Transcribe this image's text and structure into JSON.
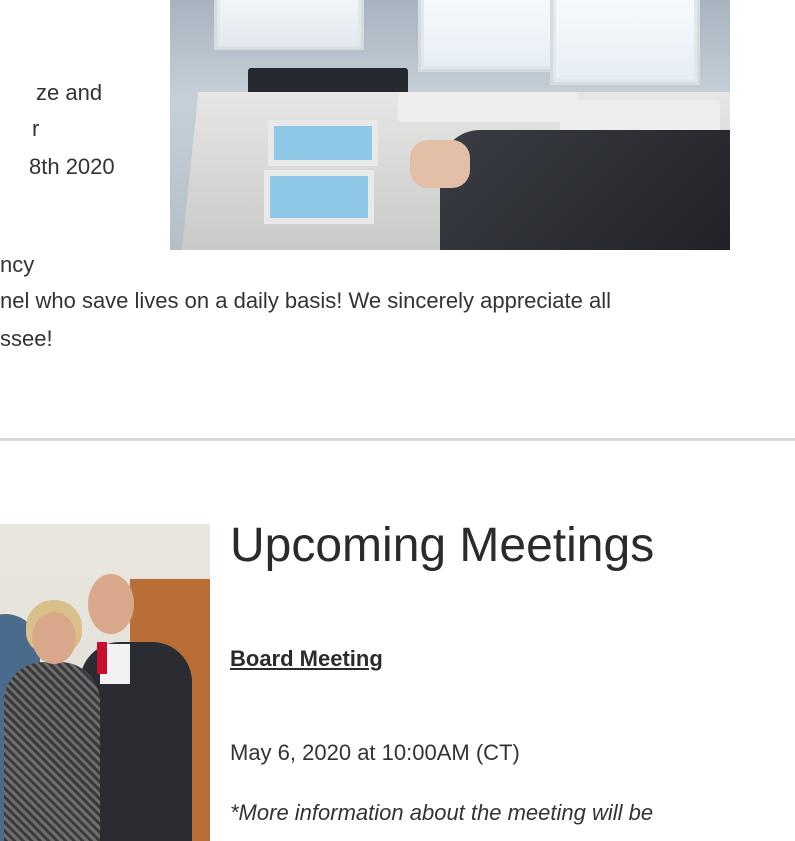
{
  "top_section": {
    "lines": [
      "ze and",
      "r",
      "8th 2020",
      "ncy"
    ],
    "paragraph_line1": "nel who save lives on a daily basis! We sincerely appreciate all",
    "paragraph_line2": "ssee!"
  },
  "meetings": {
    "heading": "Upcoming Meetings",
    "board_meeting_label": "Board Meeting",
    "date": "May 6, 2020 at 10:00AM (CT)",
    "note": "*More information about the meeting will be"
  }
}
